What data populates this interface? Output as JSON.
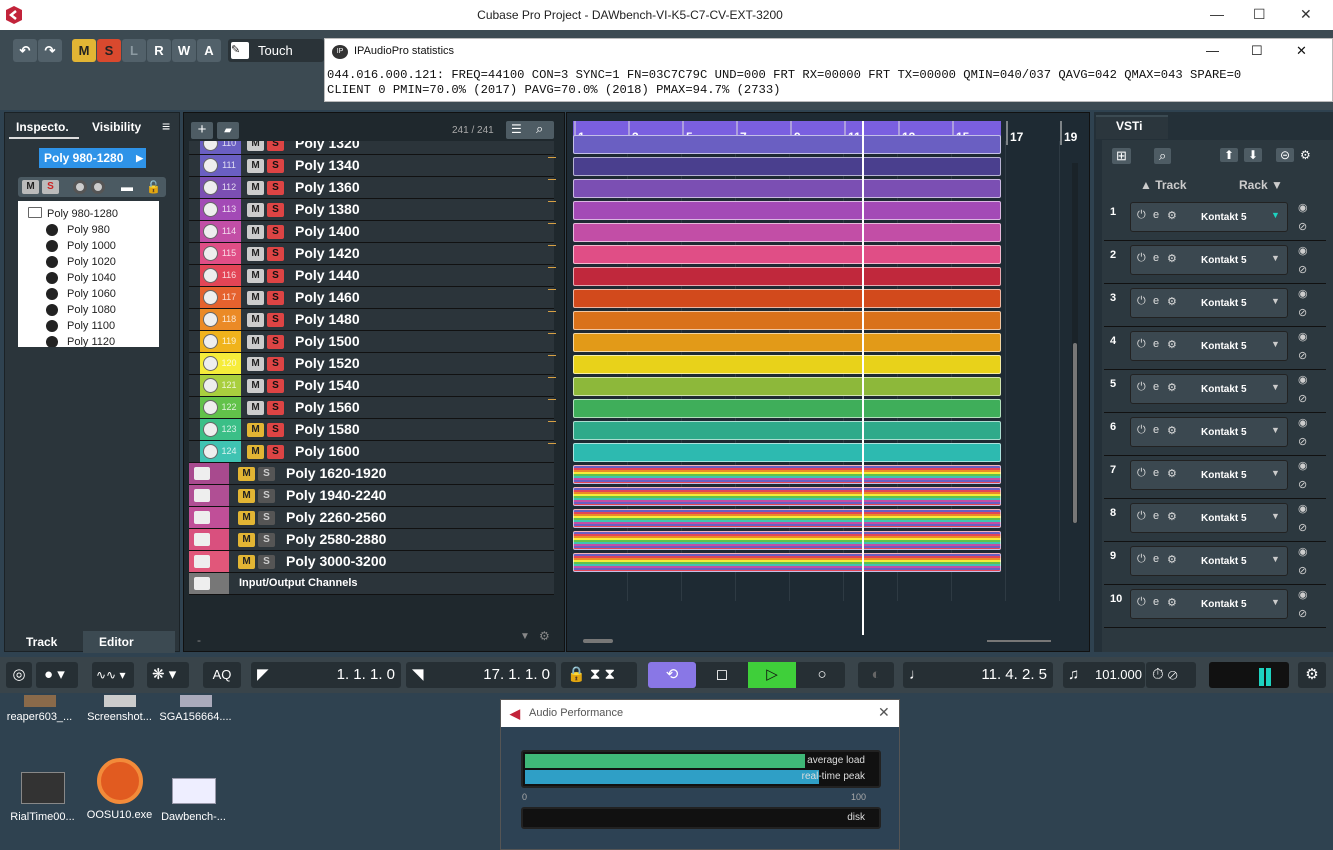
{
  "window": {
    "title": "Cubase Pro Project - DAWbench-VI-K5-C7-CV-EXT-3200",
    "minimize": "—",
    "maximize": "☐",
    "close": "✕"
  },
  "toolbar": {
    "undo": "↶",
    "redo": "↷",
    "m": "M",
    "s": "S",
    "l": "L",
    "r": "R",
    "w": "W",
    "a": "A",
    "automation_mode": "Touch"
  },
  "ipap": {
    "title": "IPAudioPro statistics",
    "line1": "044.016.000.121: FREQ=44100 CON=3 SYNC=1 FN=03C7C79C UND=000 FRT RX=00000 FRT TX=00000 QMIN=040/037 QAVG=042 QMAX=043 SPARE=0",
    "line2": "CLIENT 0 PMIN=70.0% (2017) PAVG=70.0% (2018) PMAX=94.7% (2733)",
    "minimize": "—",
    "maximize": "☐",
    "close": "✕"
  },
  "inspector": {
    "tab_inspector": "Inspecto.",
    "tab_visibility": "Visibility",
    "selected_track": "Poly 980-1280",
    "folder": "Poly 980-1280",
    "items": [
      "Poly 980",
      "Poly 1000",
      "Poly 1020",
      "Poly 1040",
      "Poly 1060",
      "Poly 1080",
      "Poly 1100",
      "Poly 1120"
    ],
    "tab_track": "Track",
    "tab_editor": "Editor"
  },
  "tracklist": {
    "count": "241 / 241",
    "partial_top": "Poly 1320",
    "partial_top_num": "110",
    "rows": [
      {
        "num": "111",
        "name": "Poly 1340",
        "color": "#6a5fc2"
      },
      {
        "num": "112",
        "name": "Poly 1360",
        "color": "#7b4fb3"
      },
      {
        "num": "113",
        "name": "Poly 1380",
        "color": "#a34ab6"
      },
      {
        "num": "115",
        "name": "Poly 1420",
        "color": "#e04e86"
      },
      {
        "num": "116",
        "name": "Poly 1440",
        "color": "#e34556"
      },
      {
        "num": "117",
        "name": "Poly 1460",
        "color": "#e5622e"
      },
      {
        "num": "118",
        "name": "Poly 1480",
        "color": "#eb8a26"
      },
      {
        "num": "119",
        "name": "Poly 1500",
        "color": "#f0b31c"
      },
      {
        "num": "120",
        "name": "Poly 1520",
        "color": "#f6ec3a"
      },
      {
        "num": "121",
        "name": "Poly 1540",
        "color": "#a9cf3e"
      },
      {
        "num": "122",
        "name": "Poly 1560",
        "color": "#62c24a"
      },
      {
        "num": "123",
        "name": "Poly 1580",
        "color": "#3bbf87"
      },
      {
        "num": "124",
        "name": "Poly 1600",
        "color": "#3fc3b2"
      }
    ],
    "row_114": {
      "num": "114",
      "name": "Poly 1400",
      "color": "#c24ea6"
    },
    "folders": [
      {
        "name": "Poly 1620-1920",
        "color": "#a84a8e"
      },
      {
        "name": "Poly 1940-2240",
        "color": "#b04f94"
      },
      {
        "name": "Poly 2260-2560",
        "color": "#c04f98"
      },
      {
        "name": "Poly 2580-2880",
        "color": "#d9507e"
      },
      {
        "name": "Poly 3000-3200",
        "color": "#e1577a"
      }
    ],
    "io": "Input/Output Channels",
    "m": "M",
    "s": "S"
  },
  "ruler": {
    "marks": [
      "1",
      "3",
      "5",
      "7",
      "9",
      "11",
      "13",
      "15",
      "17",
      "19"
    ]
  },
  "parts": {
    "colors": [
      "#6a5fc2",
      "#4a3f8e",
      "#7b4fb3",
      "#a34ab6",
      "#c24ea6",
      "#e04e86",
      "#c0283c",
      "#d24a1c",
      "#d9711a",
      "#e29a18",
      "#e8d21a",
      "#8db83a",
      "#3fae5a",
      "#2faa8a",
      "#2dbab0"
    ]
  },
  "vsti": {
    "title": "VSTi",
    "col_track": "Track",
    "col_rack": "Rack",
    "slots": [
      {
        "n": "1",
        "name": "Kontakt 5"
      },
      {
        "n": "2",
        "name": "Kontakt 5"
      },
      {
        "n": "3",
        "name": "Kontakt 5"
      },
      {
        "n": "4",
        "name": "Kontakt 5"
      },
      {
        "n": "5",
        "name": "Kontakt 5"
      },
      {
        "n": "6",
        "name": "Kontakt 5"
      },
      {
        "n": "7",
        "name": "Kontakt 5"
      },
      {
        "n": "8",
        "name": "Kontakt 5"
      },
      {
        "n": "9",
        "name": "Kontakt 5"
      },
      {
        "n": "10",
        "name": "Kontakt 5"
      }
    ]
  },
  "transport": {
    "aq": "AQ",
    "left_locator": "1. 1. 1.   0",
    "right_locator": "17. 1. 1.   0",
    "position": "11. 4. 2.   5",
    "tempo": "101.000"
  },
  "desktop": [
    {
      "label": "reaper603_..."
    },
    {
      "label": "Screenshot..."
    },
    {
      "label": "SGA156664...."
    },
    {
      "label": "RialTime00..."
    },
    {
      "label": "OOSU10.exe"
    },
    {
      "label": "Dawbench-..."
    }
  ],
  "audio_performance": {
    "title": "Audio Performance",
    "average_load": "average load",
    "realtime_peak": "real-time peak",
    "scale_min": "0",
    "scale_max": "100",
    "disk": "disk",
    "avg_load_pct": 80,
    "peak_pct": 84,
    "close": "✕"
  }
}
